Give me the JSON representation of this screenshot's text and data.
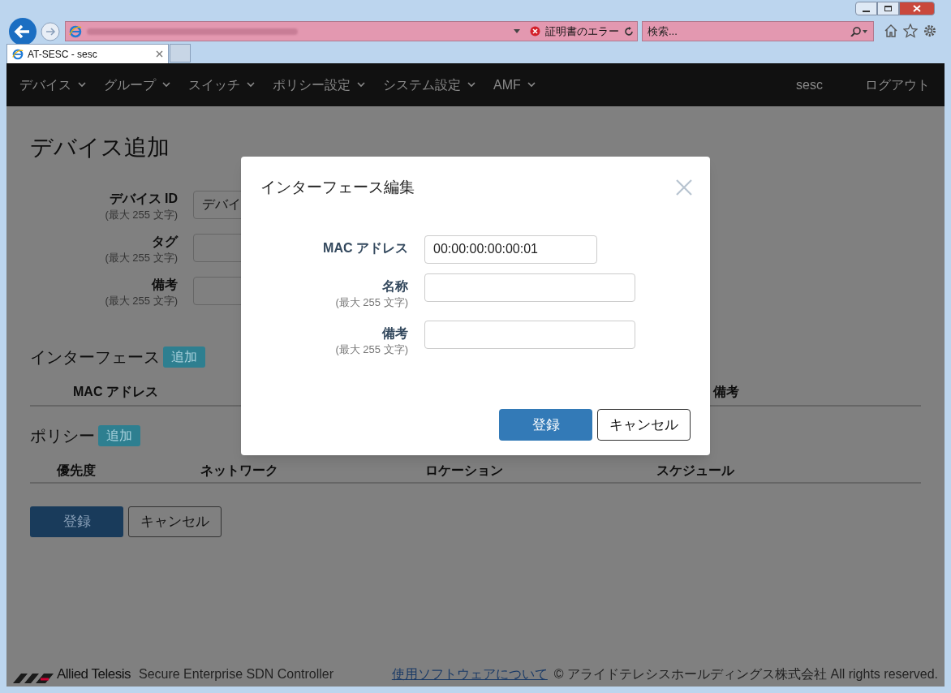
{
  "browser": {
    "tab_title": "AT-SESC - sesc",
    "cert_error": "証明書のエラー",
    "search_placeholder": "検索..."
  },
  "nav": {
    "items": [
      {
        "label": "デバイス"
      },
      {
        "label": "グループ"
      },
      {
        "label": "スイッチ"
      },
      {
        "label": "ポリシー設定"
      },
      {
        "label": "システム設定"
      },
      {
        "label": "AMF"
      }
    ],
    "user": "sesc",
    "logout": "ログアウト"
  },
  "page": {
    "title": "デバイス追加",
    "fields": [
      {
        "label": "デバイス ID",
        "hint": "(最大 255 文字)",
        "value": "デバイ"
      },
      {
        "label": "タグ",
        "hint": "(最大 255 文字)"
      },
      {
        "label": "備考",
        "hint": "(最大 255 文字)"
      }
    ],
    "interfaces": {
      "title": "インターフェース",
      "add_button": "追加",
      "columns": [
        "MAC アドレス",
        "備考"
      ]
    },
    "policies": {
      "title": "ポリシー",
      "add_button": "追加",
      "columns": [
        "優先度",
        "ネットワーク",
        "ロケーション",
        "スケジュール"
      ]
    },
    "submit": "登録",
    "cancel": "キャンセル"
  },
  "modal": {
    "title": "インターフェース編集",
    "fields": [
      {
        "label": "**MAC** アドレス",
        "value": "00:00:00:00:00:01"
      },
      {
        "label": "名称",
        "hint": "(最大 255 文字)"
      },
      {
        "label": "備考",
        "hint": "(最大 255 文字)"
      }
    ],
    "submit": "登録",
    "cancel": "キャンセル"
  },
  "footer": {
    "brand": "Allied Telesis",
    "product": "Secure Enterprise SDN Controller",
    "link": "使用ソフトウェアについて",
    "copyright": "© アライドテレシスホールディングス株式会社 All rights reserved."
  }
}
